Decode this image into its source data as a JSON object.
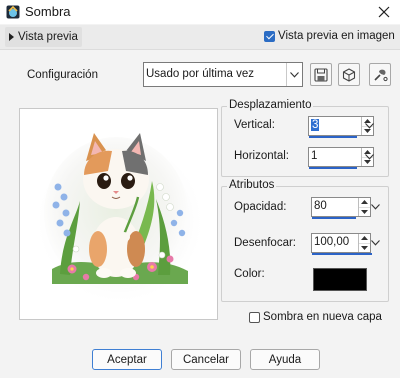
{
  "window": {
    "title": "Sombra"
  },
  "preview": {
    "toggle_label": "Vista previa",
    "image_preview_label": "Vista previa en imagen",
    "image_preview_checked": true
  },
  "config": {
    "label": "Configuración",
    "selected": "Usado por última vez"
  },
  "displacement": {
    "title": "Desplazamiento",
    "vertical_label": "Vertical:",
    "vertical_value": "3",
    "horizontal_label": "Horizontal:",
    "horizontal_value": "1"
  },
  "attributes": {
    "title": "Atributos",
    "opacity_label": "Opacidad:",
    "opacity_value": "80",
    "blur_label": "Desenfocar:",
    "blur_value": "100,00",
    "color_label": "Color:",
    "color_hex": "#000000"
  },
  "new_layer": {
    "label": "Sombra en nueva capa",
    "checked": false
  },
  "buttons": {
    "ok": "Aceptar",
    "cancel": "Cancelar",
    "help": "Ayuda"
  }
}
